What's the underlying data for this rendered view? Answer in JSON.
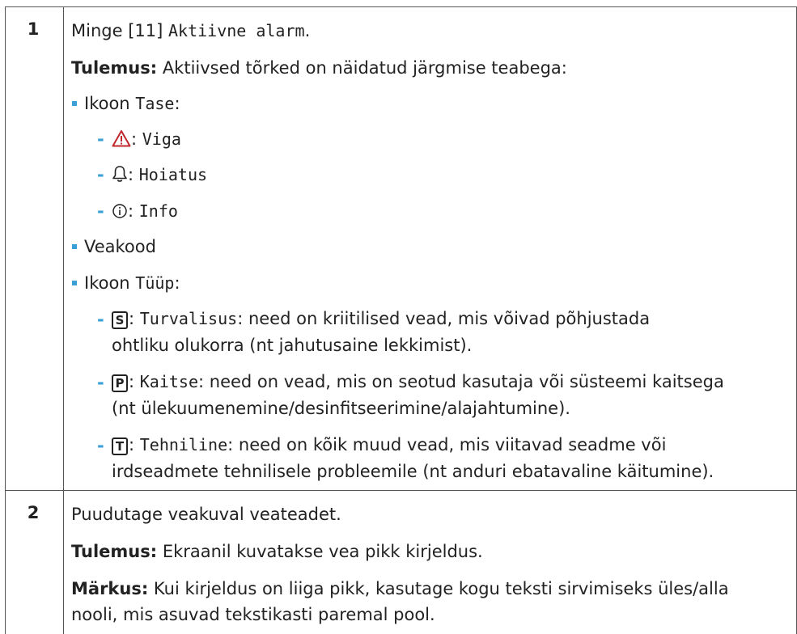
{
  "step1": {
    "number": "1",
    "intro_text": "Minge [11] ",
    "intro_mono": "Aktiivne alarm",
    "intro_end": ".",
    "result_label": "Tulemus:",
    "result_text": " Aktiivsed tõrked on näidatud järgmise teabega:",
    "level_prefix": "Ikoon ",
    "level_mono": "Tase",
    "level_suffix": ":",
    "levels": [
      {
        "icon": "warning-triangle-icon",
        "sep": ": ",
        "label": "Viga"
      },
      {
        "icon": "bell-icon",
        "sep": ": ",
        "label": "Hoiatus"
      },
      {
        "icon": "info-circle-icon",
        "sep": ": ",
        "label": "Info"
      }
    ],
    "error_code": "Veakood",
    "type_prefix": "Ikoon ",
    "type_mono": "Tüüp",
    "type_suffix": ":",
    "types": [
      {
        "glyph": "S",
        "label": "Turvalisus",
        "desc_line1": ": need on kriitilised vead, mis võivad põhjustada",
        "desc_line2": "ohtliku olukorra (nt jahutusaine lekkimist)."
      },
      {
        "glyph": "P",
        "label": "Kaitse",
        "desc_line1": ": need on vead, mis on seotud kasutaja või süsteemi kaitsega",
        "desc_line2": "(nt ülekuumenemine/desinfitseerimine/alajahtumine)."
      },
      {
        "glyph": "T",
        "label": "Tehniline",
        "desc_line1": ": need on kõik muud vead, mis viitavad seadme või",
        "desc_line2": "irdseadmete tehnilisele probleemile (nt anduri ebatavaline käitumine)."
      }
    ]
  },
  "step2": {
    "number": "2",
    "text": "Puudutage veakuval veateadet.",
    "result_label": "Tulemus:",
    "result_text": " Ekraanil kuvatakse vea pikk kirjeldus.",
    "note_label": "Märkus:",
    "note_line1": " Kui kirjeldus on liiga pikk, kasutage kogu teksti sirvimiseks üles/alla",
    "note_line2": "nooli, mis asuvad tekstikasti paremal pool."
  },
  "colors": {
    "accent": "#3aa0d6",
    "warning": "#c0272d",
    "border": "#555555"
  }
}
